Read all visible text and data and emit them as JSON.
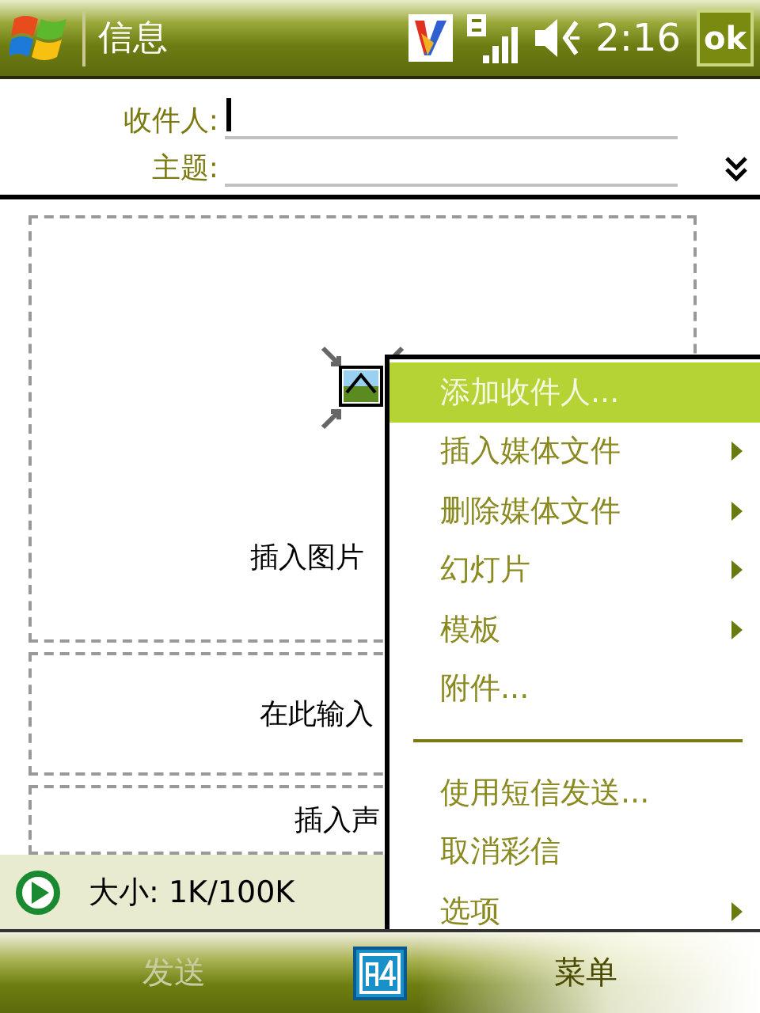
{
  "title_bar": {
    "title": "信息",
    "time": "2:16",
    "ok_label": "ok"
  },
  "header": {
    "fields": [
      {
        "label": "收件人:",
        "focused": true
      },
      {
        "label": "主题:",
        "focused": false
      }
    ]
  },
  "slide": {
    "regions": [
      {
        "kind": "picture",
        "text": "插入图片"
      },
      {
        "kind": "text",
        "text": "在此输入"
      },
      {
        "kind": "audio",
        "text": "插入声"
      }
    ]
  },
  "status_bar": {
    "size": "大小: 1K/100K"
  },
  "menu": {
    "items": [
      {
        "kind": "item",
        "label": "添加收件人...",
        "submenu": false,
        "selected": true
      },
      {
        "kind": "item",
        "label": "插入媒体文件",
        "submenu": true,
        "selected": false
      },
      {
        "kind": "item",
        "label": "删除媒体文件",
        "submenu": true,
        "selected": false
      },
      {
        "kind": "item",
        "label": "幻灯片",
        "submenu": true,
        "selected": false
      },
      {
        "kind": "item",
        "label": "模板",
        "submenu": true,
        "selected": false
      },
      {
        "kind": "item",
        "label": "附件...",
        "submenu": false,
        "selected": false
      },
      {
        "kind": "separator"
      },
      {
        "kind": "item",
        "label": "使用短信发送...",
        "submenu": false,
        "selected": false
      },
      {
        "kind": "item",
        "label": "取消彩信",
        "submenu": false,
        "selected": false
      },
      {
        "kind": "item",
        "label": "选项",
        "submenu": true,
        "selected": false
      }
    ]
  },
  "softkeys": [
    {
      "label": "发送",
      "disabled": true
    },
    {
      "label": "菜单",
      "disabled": false
    }
  ]
}
